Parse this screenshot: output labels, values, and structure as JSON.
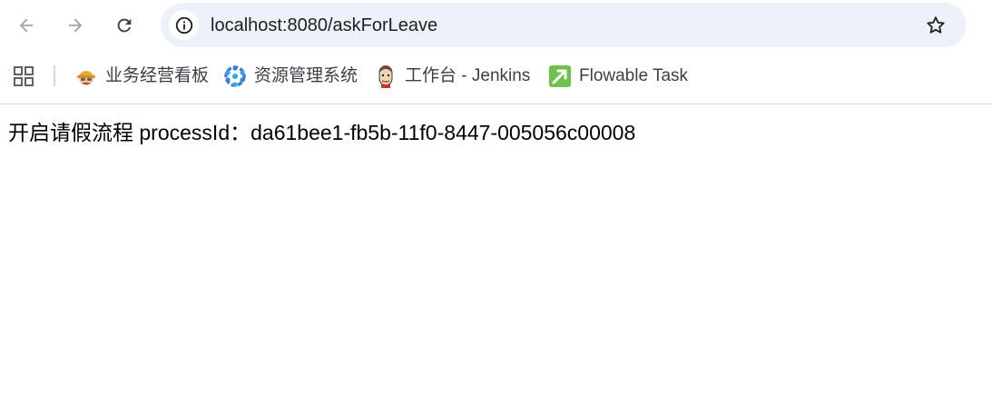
{
  "browser": {
    "url": "localhost:8080/askForLeave",
    "icons": {
      "back": "arrow-left-icon",
      "forward": "arrow-right-icon",
      "reload": "reload-icon",
      "site_info": "info-icon",
      "bookmark_star": "star-icon",
      "apps": "apps-grid-icon"
    }
  },
  "bookmarks": [
    {
      "label": "业务经营看板",
      "icon": "worker-helmet-icon"
    },
    {
      "label": "资源管理系统",
      "icon": "flower-network-icon"
    },
    {
      "label": "工作台 - Jenkins",
      "icon": "jenkins-icon"
    },
    {
      "label": "Flowable Task",
      "icon": "flowable-icon"
    }
  ],
  "page": {
    "text": "开启请假流程 processId：da61bee1-fb5b-11f0-8447-005056c00008"
  },
  "colors": {
    "omnibox_bg": "#edf1f9",
    "icon_gray": "#5f6368",
    "flowable_green": "#6cc24a"
  }
}
